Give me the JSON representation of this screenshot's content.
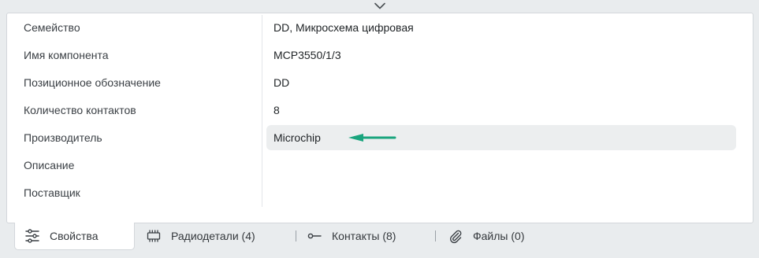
{
  "properties": [
    {
      "label": "Семейство",
      "value": "DD, Микросхема цифровая"
    },
    {
      "label": "Имя компонента",
      "value": "MCP3550/1/3"
    },
    {
      "label": "Позиционное обозначение",
      "value": "DD"
    },
    {
      "label": "Количество контактов",
      "value": "8"
    },
    {
      "label": "Производитель",
      "value": "Microchip"
    },
    {
      "label": "Описание",
      "value": ""
    },
    {
      "label": "Поставщик",
      "value": ""
    }
  ],
  "tabs": [
    {
      "label": "Свойства",
      "icon": "sliders-icon",
      "active": true
    },
    {
      "label": "Радиодетали (4)",
      "icon": "chip-icon",
      "active": false
    },
    {
      "label": "Контакты (8)",
      "icon": "pin-icon",
      "active": false
    },
    {
      "label": "Файлы (0)",
      "icon": "paperclip-icon",
      "active": false
    }
  ],
  "colors": {
    "arrow": "#1aa57e",
    "selected_bg": "#eceeef"
  }
}
